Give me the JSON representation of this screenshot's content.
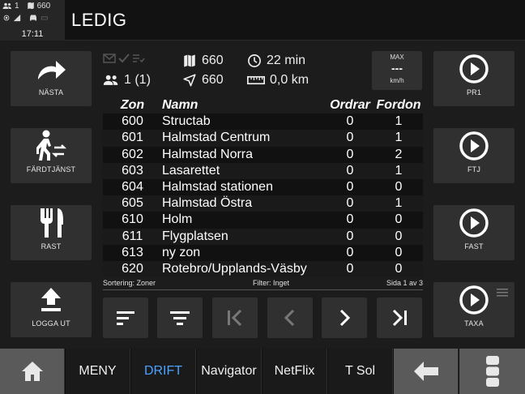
{
  "status": {
    "people_count": "1",
    "map_count": "660",
    "time": "17:11"
  },
  "header": {
    "title": "LEDIG"
  },
  "left_buttons": [
    {
      "label": "NÄSTA"
    },
    {
      "label": "FÄRDTJÄNST"
    },
    {
      "label": "RAST"
    },
    {
      "label": "LOGGA UT"
    }
  ],
  "right_buttons": [
    {
      "label": "PR1"
    },
    {
      "label": "FTJ"
    },
    {
      "label": "FAST"
    },
    {
      "label": "TAXA"
    }
  ],
  "info": {
    "passengers": "1 (1)",
    "zone_map": "660",
    "zone_nav": "660",
    "eta": "22 min",
    "distance": "0,0 km"
  },
  "max_speed": {
    "title": "MAX",
    "value": "---",
    "unit": "km/h"
  },
  "table": {
    "headers": {
      "zon": "Zon",
      "namn": "Namn",
      "ordrar": "Ordrar",
      "fordon": "Fordon"
    },
    "rows": [
      {
        "zon": "600",
        "namn": "Structab",
        "ordrar": "0",
        "fordon": "1"
      },
      {
        "zon": "601",
        "namn": "Halmstad Centrum",
        "ordrar": "0",
        "fordon": "1"
      },
      {
        "zon": "602",
        "namn": "Halmstad Norra",
        "ordrar": "0",
        "fordon": "2"
      },
      {
        "zon": "603",
        "namn": "Lasarettet",
        "ordrar": "0",
        "fordon": "1"
      },
      {
        "zon": "604",
        "namn": "Halmstad stationen",
        "ordrar": "0",
        "fordon": "0"
      },
      {
        "zon": "605",
        "namn": "Halmstad Östra",
        "ordrar": "0",
        "fordon": "1"
      },
      {
        "zon": "610",
        "namn": "Holm",
        "ordrar": "0",
        "fordon": "0"
      },
      {
        "zon": "611",
        "namn": "Flygplatsen",
        "ordrar": "0",
        "fordon": "0"
      },
      {
        "zon": "613",
        "namn": "ny zon",
        "ordrar": "0",
        "fordon": "0"
      },
      {
        "zon": "620",
        "namn": "Rotebro/Upplands-Väsby",
        "ordrar": "0",
        "fordon": "0"
      }
    ],
    "footer": {
      "sorting": "Sortering: Zoner",
      "filter": "Filter: Inget",
      "page": "Sida 1 av 3"
    }
  },
  "nav": {
    "meny": "MENY",
    "drift": "DRIFT",
    "navigator": "Navigator",
    "netflix": "NetFlix",
    "tsol": "T Sol"
  },
  "colors": {
    "accent": "#4aa3ff",
    "background": "#1c1c1c",
    "button": "#303030"
  }
}
